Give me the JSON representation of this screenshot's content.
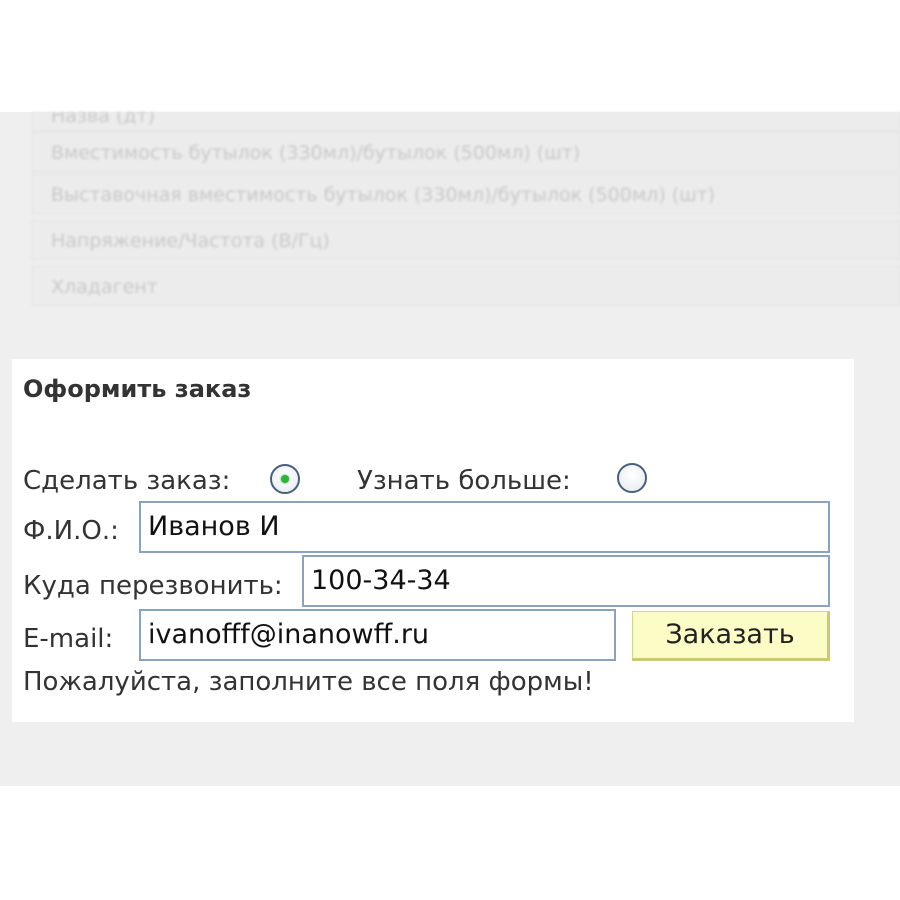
{
  "spec_rows": [
    "Назва (дт)",
    "Вместимость бутылок (330мл)/бутылок (500мл) (шт)",
    "Выставочная вместимость бутылок (330мл)/бутылок (500мл) (шт)",
    "Напряжение/Частота (В/Гц)",
    "Хладагент"
  ],
  "order_form": {
    "title": "Оформить заказ",
    "radio_order_label": "Сделать заказ:",
    "radio_order_selected": true,
    "radio_info_label": "Узнать больше:",
    "radio_info_selected": false,
    "name_label": "Ф.И.О.:",
    "name_value": "Иванов И",
    "phone_label": "Куда перезвонить:",
    "phone_value": "100-34-34",
    "email_label": "E-mail:",
    "email_value": "ivanofff@inanowff.ru",
    "submit_label": "Заказать",
    "notice": "Пожалуйста, заполните все поля формы!"
  },
  "colors": {
    "accent_radio": "#2fb33c",
    "button_bg": "#fcfcc6",
    "field_border": "#8aa3bf",
    "page_gray": "#efefef"
  }
}
